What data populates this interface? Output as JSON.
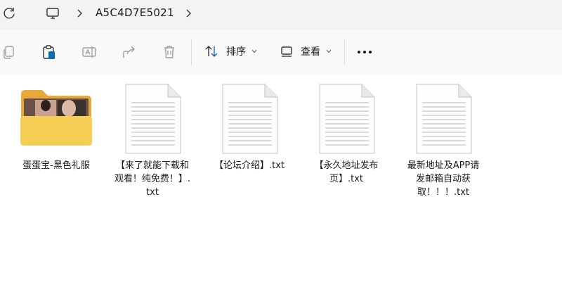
{
  "address_bar": {
    "path_segment": "A5C4D7E5021",
    "icons": [
      "refresh-icon",
      "monitor-icon",
      "chevron-right-icon"
    ]
  },
  "command_bar": {
    "sort_label": "排序",
    "view_label": "查看",
    "icons": [
      "copy-icon",
      "paste-icon",
      "rename-icon",
      "share-icon",
      "delete-icon",
      "sort-icon",
      "view-icon",
      "more-icon"
    ]
  },
  "files": [
    {
      "name": "蛋蛋宝-黑色礼服",
      "type": "folder"
    },
    {
      "name": "【来了就能下载和观看！纯免费！】.txt",
      "type": "txt"
    },
    {
      "name": "【论坛介绍】.txt",
      "type": "txt"
    },
    {
      "name": "【永久地址发布页】.txt",
      "type": "txt"
    },
    {
      "name": "最新地址及APP请发邮箱自动获取！！！.txt",
      "type": "txt"
    }
  ],
  "colors": {
    "folder_back": "#e8a93a",
    "folder_front": "#f7ce55",
    "accent": "#0f6cbd"
  }
}
